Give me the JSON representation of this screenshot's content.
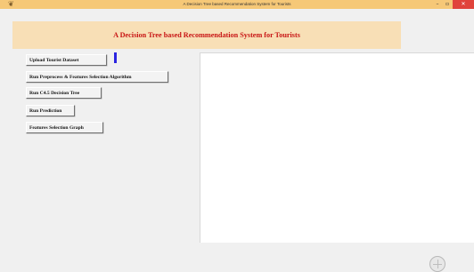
{
  "window": {
    "title": "A Decision Tree based Recommendation System for Tourists",
    "icon": "feather-icon",
    "controls": {
      "minimize": "–",
      "maximize": "▫",
      "close": "✕"
    }
  },
  "header": {
    "title": "A Decision Tree based Recommendation System for Tourists",
    "title_color": "#c81414",
    "background": "#f8dfb6"
  },
  "buttons": [
    {
      "label": "Upload Tourist Dataset"
    },
    {
      "label": "Run Preprocess & Features Selection Algorithm"
    },
    {
      "label": "Run C4.5 Decision Tree"
    },
    {
      "label": "Run Prediction"
    },
    {
      "label": "Features Selection Graph"
    }
  ],
  "colors": {
    "titlebar": "#f6c877",
    "status_indicator": "#2a24e0",
    "close": "#e0433b"
  }
}
